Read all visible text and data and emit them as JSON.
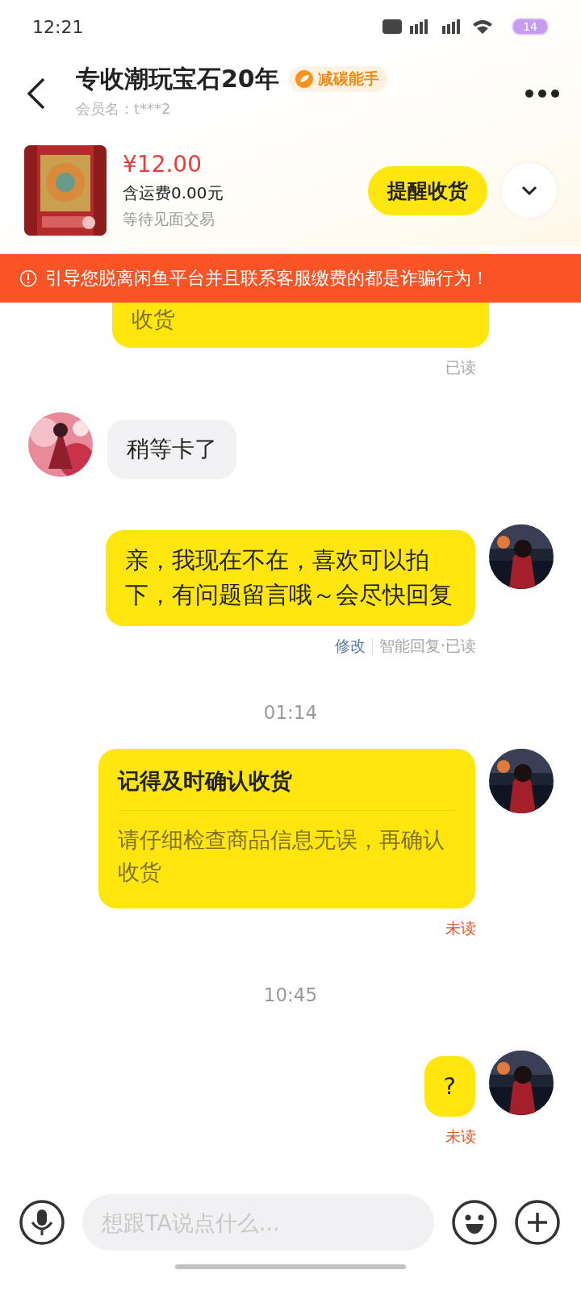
{
  "status_bar": {
    "time": "12:21",
    "battery": "14"
  },
  "header": {
    "title": "专收潮玩宝石20年",
    "badge": "减碳能手",
    "member": "会员名：t***2"
  },
  "order": {
    "price": "¥12.00",
    "shipping": "含运费0.00元",
    "status": "等待见面交易",
    "action": "提醒收货"
  },
  "warning": "引导您脱离闲鱼平台并且联系客服缴费的都是诈骗行为！",
  "messages": [
    {
      "kind": "card_tail",
      "body": "收货",
      "receipt": "已读",
      "read": true
    },
    {
      "kind": "incoming",
      "text": "稍等卡了"
    },
    {
      "kind": "outgoing",
      "text": "亲，我现在不在，喜欢可以拍下，有问题留言哦～会尽快回复",
      "edit": "修改",
      "receipt": "智能回复·已读",
      "read": true
    },
    {
      "kind": "time",
      "text": "01:14"
    },
    {
      "kind": "card",
      "title": "记得及时确认收货",
      "body": "请仔细检查商品信息无误，再确认收货",
      "receipt": "未读",
      "read": false
    },
    {
      "kind": "time",
      "text": "10:45"
    },
    {
      "kind": "outgoing",
      "text": "?",
      "receipt": "未读",
      "read": false
    }
  ],
  "input": {
    "placeholder": "想跟TA说点什么..."
  }
}
